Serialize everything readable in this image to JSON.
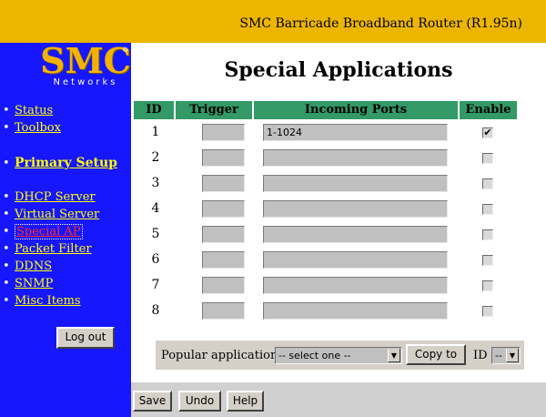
{
  "header": {
    "title": "SMC Barricade Broadband Router (R1.95n)"
  },
  "logo": {
    "main": "SMC",
    "sub": "Networks",
    "reg": "®"
  },
  "nav": {
    "status": "Status",
    "toolbox": "Toolbox",
    "primary_setup": "Primary Setup",
    "dhcp_server": "DHCP Server",
    "virtual_server": "Virtual Server",
    "special_ap": "Special AP",
    "packet_filter": "Packet Filter",
    "ddns": "DDNS",
    "snmp": "SNMP",
    "misc_items": "Misc Items",
    "logout": "Log out"
  },
  "page": {
    "title": "Special Applications"
  },
  "table": {
    "headers": {
      "id": "ID",
      "trigger": "Trigger",
      "incoming": "Incoming Ports",
      "enable": "Enable"
    },
    "rows": [
      {
        "id": "1",
        "trigger": "",
        "incoming": "1-1024",
        "enabled": "✔"
      },
      {
        "id": "2",
        "trigger": "",
        "incoming": "",
        "enabled": ""
      },
      {
        "id": "3",
        "trigger": "",
        "incoming": "",
        "enabled": ""
      },
      {
        "id": "4",
        "trigger": "",
        "incoming": "",
        "enabled": ""
      },
      {
        "id": "5",
        "trigger": "",
        "incoming": "",
        "enabled": ""
      },
      {
        "id": "6",
        "trigger": "",
        "incoming": "",
        "enabled": ""
      },
      {
        "id": "7",
        "trigger": "",
        "incoming": "",
        "enabled": ""
      },
      {
        "id": "8",
        "trigger": "",
        "incoming": "",
        "enabled": ""
      }
    ]
  },
  "popular": {
    "label": "Popular applications",
    "select_value": "-- select one --",
    "copy_to": "Copy to",
    "id_label": "ID",
    "id_value": "--"
  },
  "actions": {
    "save": "Save",
    "undo": "Undo",
    "help": "Help"
  },
  "icons": {
    "dropdown": "▼"
  },
  "colors": {
    "header_bg": "#ecb600",
    "sidebar_bg": "#1616ff",
    "table_header": "#339966",
    "link": "#ffff00"
  }
}
